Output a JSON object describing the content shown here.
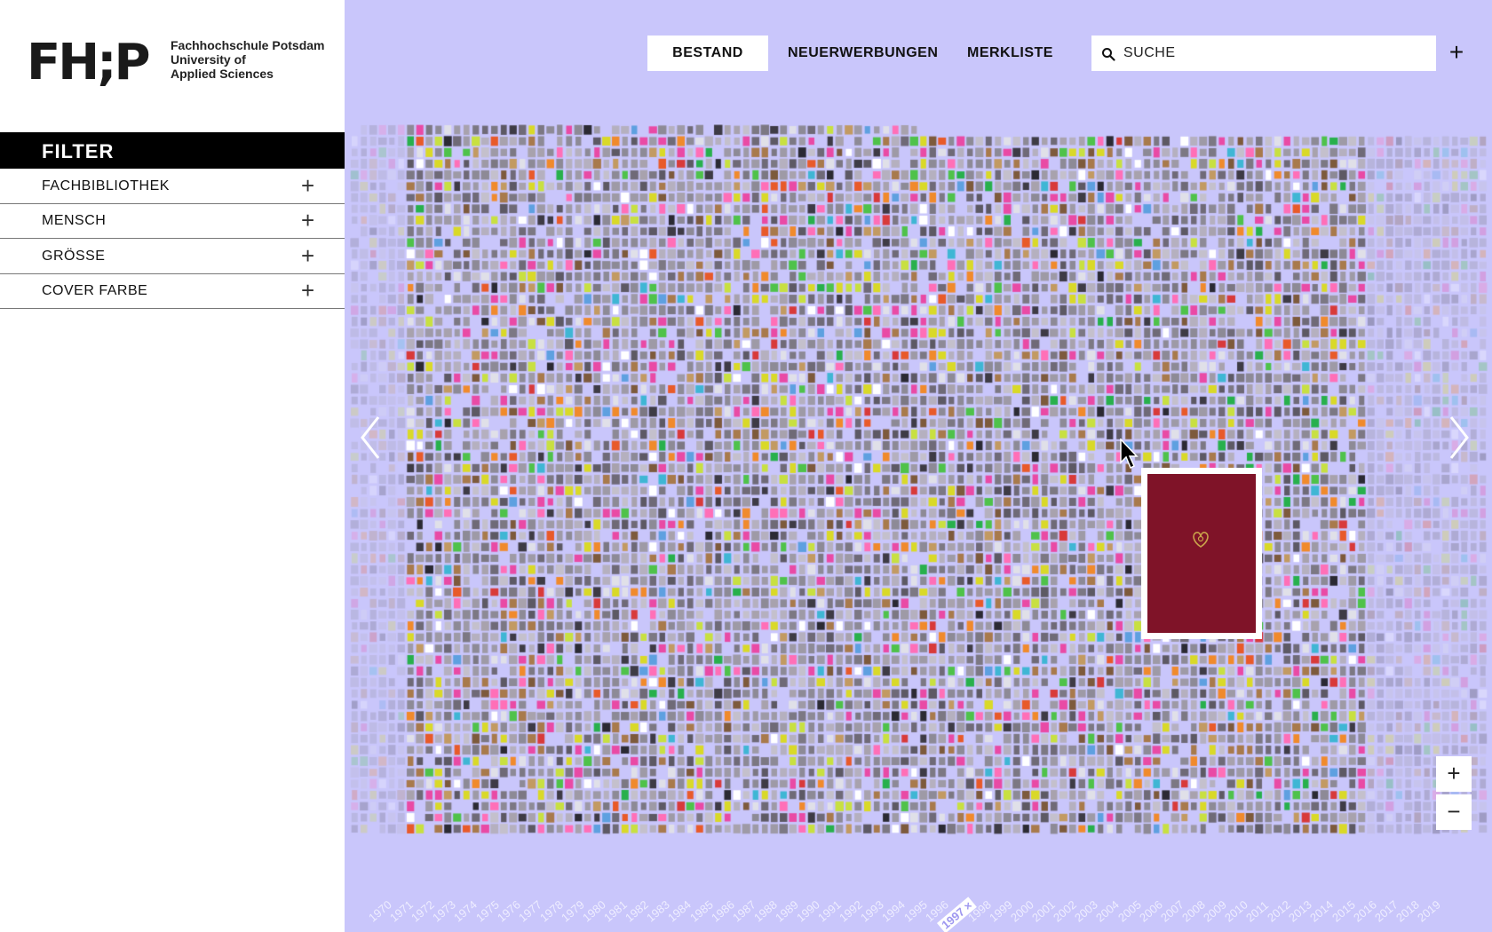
{
  "logo": {
    "mark": "FH;P",
    "line1": "Fachhochschule Potsdam",
    "line2": "University of",
    "line3": "Applied Sciences"
  },
  "sidebar": {
    "header": "FILTER",
    "items": [
      {
        "label": "FACHBIBLIOTHEK"
      },
      {
        "label": "MENSCH"
      },
      {
        "label": "GRÖSSE"
      },
      {
        "label": "COVER FARBE"
      }
    ],
    "plus_symbol": "+"
  },
  "nav": {
    "tabs": [
      {
        "label": "BESTAND",
        "active": true
      },
      {
        "label": "NEUERWERBUNGEN",
        "active": false
      },
      {
        "label": "MERKLISTE",
        "active": false
      }
    ]
  },
  "search": {
    "placeholder": "SUCHE",
    "value": ""
  },
  "add_symbol": "+",
  "zoom": {
    "in": "+",
    "out": "−"
  },
  "colors": {
    "background": "#c9c6fb",
    "preview_cover": "#7f1328",
    "sidebar_header": "#000000"
  },
  "timeline": {
    "years": [
      "1970",
      "1971",
      "1972",
      "1973",
      "1974",
      "1975",
      "1976",
      "1977",
      "1978",
      "1979",
      "1980",
      "1981",
      "1982",
      "1983",
      "1984",
      "1985",
      "1986",
      "1987",
      "1988",
      "1989",
      "1990",
      "1991",
      "1992",
      "1993",
      "1994",
      "1995",
      "1996",
      "1997",
      "1998",
      "1999",
      "2000",
      "2001",
      "2002",
      "2003",
      "2004",
      "2005",
      "2006",
      "2007",
      "2008",
      "2009",
      "2010",
      "2011",
      "2012",
      "2013",
      "2014",
      "2015",
      "2016",
      "2017",
      "2018",
      "2019"
    ],
    "selected": "1997",
    "selected_close": "×"
  },
  "icons": {
    "search": "search-icon",
    "arrow_left": "chevron-left-icon",
    "arrow_right": "chevron-right-icon",
    "cursor": "mouse-pointer-icon"
  }
}
